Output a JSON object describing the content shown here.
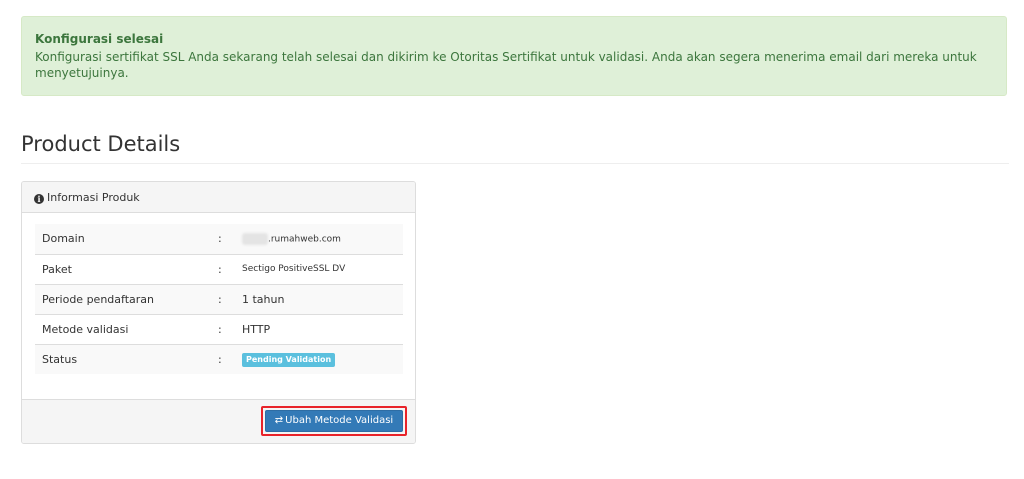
{
  "alert": {
    "title": "Konfigurasi selesai",
    "message": "Konfigurasi sertifikat SSL Anda sekarang telah selesai dan dikirim ke Otoritas Sertifikat untuk validasi. Anda akan segera menerima email dari mereka untuk menyetujuinya."
  },
  "page": {
    "title": "Product Details"
  },
  "panel": {
    "heading": "Informasi Produk",
    "icon": "info-circle-icon",
    "rows": [
      {
        "label": "Domain",
        "colon": ":",
        "value": ".rumahweb.com"
      },
      {
        "label": "Paket",
        "colon": ":",
        "value": "Sectigo PositiveSSL DV"
      },
      {
        "label": "Periode pendaftaran",
        "colon": ":",
        "value": "1 tahun"
      },
      {
        "label": "Metode validasi",
        "colon": ":",
        "value": "HTTP"
      },
      {
        "label": "Status",
        "colon": ":",
        "value": "Pending Validation"
      }
    ],
    "button_label": "Ubah Metode Validasi",
    "button_icon": "exchange-icon"
  },
  "colors": {
    "alert_bg": "#dff0d8",
    "alert_text": "#3c763d",
    "badge_info": "#5bc0de",
    "primary": "#337ab7",
    "highlight": "#e8232a"
  }
}
